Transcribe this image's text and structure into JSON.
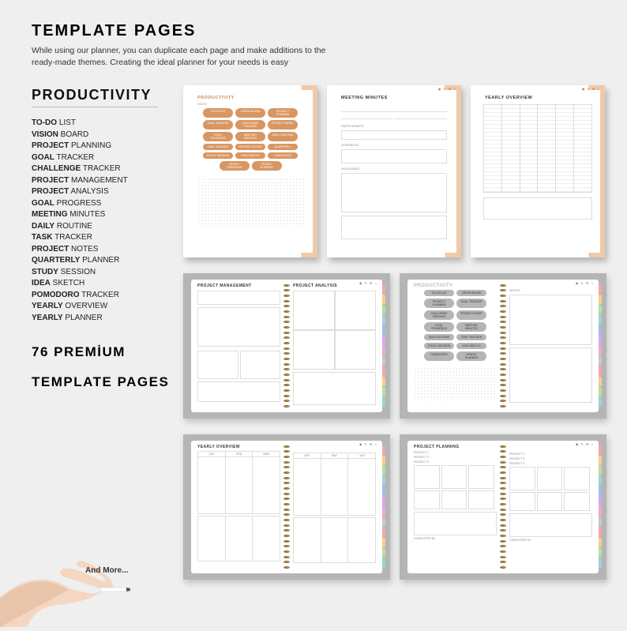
{
  "header": {
    "title": "TEMPLATE PAGES",
    "subtitle": "While using our planner, you can duplicate each page and make additions to the ready-made themes. Creating the ideal planner for your needs is easy"
  },
  "section": {
    "title": "PRODUCTIVITY"
  },
  "list": [
    {
      "b": "TO-DO",
      "r": " LIST"
    },
    {
      "b": "VISION",
      "r": " BOARD"
    },
    {
      "b": "PROJECT",
      "r": " PLANNING"
    },
    {
      "b": "GOAL",
      "r": " TRACKER"
    },
    {
      "b": "CHALLENGE",
      "r": " TRACKER"
    },
    {
      "b": "PROJECT",
      "r": " MANAGEMENT"
    },
    {
      "b": "PROJECT",
      "r": " ANALYSIS"
    },
    {
      "b": "GOAL",
      "r": " PROGRESS"
    },
    {
      "b": "MEETING",
      "r": " MINUTES"
    },
    {
      "b": "DAILY",
      "r": " ROUTINE"
    },
    {
      "b": "TASK",
      "r": " TRACKER"
    },
    {
      "b": "PROJECT",
      "r": " NOTES"
    },
    {
      "b": "QUARTERLY",
      "r": " PLANNER"
    },
    {
      "b": "STUDY",
      "r": " SESSION"
    },
    {
      "b": "IDEA",
      "r": " SKETCH"
    },
    {
      "b": "POMODORO",
      "r": " TRACKER"
    },
    {
      "b": "YEARLY",
      "r": " OVERVIEW"
    },
    {
      "b": "YEARLY",
      "r": " PLANNER"
    }
  ],
  "premium": "76 PREMİUM",
  "tp2": "TEMPLATE PAGES",
  "andmore": "And More...",
  "cards": {
    "c1": {
      "title": "PRODUCTIVITY",
      "sub": "INDEX",
      "pills": [
        "TO-DO LIST",
        "VISION BOARD",
        "PROJECT PLANNER",
        "GOAL TRACKER",
        "CHALLENGE TRACKER",
        "PROJECT MGMT",
        "GOAL PROGRESS",
        "MEETING MINUTES",
        "DAILY ROUTINE",
        "TASK TRACKER",
        "PROJECT NOTES",
        "QUARTERLY",
        "STUDY SESSION",
        "IDEA SKETCH",
        "POMODORO",
        "YEARLY OVERVIEW",
        "YEARLY PLANNER"
      ]
    },
    "c2": {
      "title": "MEETING MINUTES",
      "labels": [
        "PARTICIPANTS",
        "STRENGTH",
        "DISCUSSED"
      ]
    },
    "c3": {
      "title": "YEARLY OVERVIEW"
    }
  },
  "books": {
    "b1": {
      "l": "PROJECT MANAGEMENT",
      "r": "PROJECT ANALYSIS"
    },
    "b2": {
      "l": "PRODUCTIVITY",
      "r": "NOTES",
      "pills": [
        "TO-DO LIST",
        "VISION BOARD",
        "PROJECT PLANNER",
        "GOAL TRACKER",
        "CHALLENGE TRACKER",
        "PROJECT MGMT",
        "GOAL PROGRESS",
        "MEETING MINUTES",
        "DAILY ROUTINE",
        "TASK TRACKER",
        "STUDY SESSION",
        "IDEA SKETCH",
        "POMODORO",
        "YEARLY PLANNER"
      ]
    },
    "b3": {
      "l": "YEARLY OVERVIEW"
    },
    "b4": {
      "l": "PROJECT PLANNING",
      "labels": [
        "PROJECT 1",
        "PROJECT 2",
        "PROJECT 3",
        "PROJECT 4",
        "PROJECT 5",
        "PROJECT 6"
      ],
      "cb": "COMPLETED BY"
    }
  },
  "tabcolors": [
    "#f4a6a6",
    "#f4d08a",
    "#b4e19a",
    "#9ad4d9",
    "#a6b8f4",
    "#d8a6f4",
    "#f4a6d1",
    "#c8c8c8",
    "#f4a6a6",
    "#f4d08a",
    "#b4e19a",
    "#9ad4d9"
  ]
}
